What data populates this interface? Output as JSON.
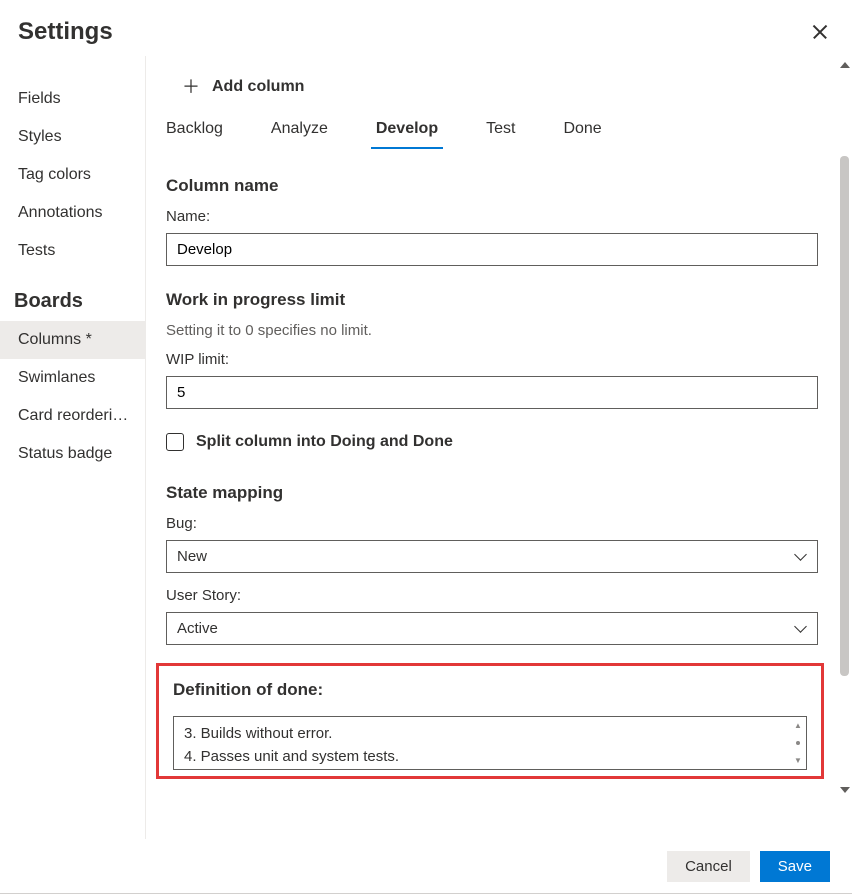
{
  "header": {
    "title": "Settings"
  },
  "sidebar": {
    "groups": [
      {
        "heading": null,
        "items": [
          {
            "label": "Fields"
          },
          {
            "label": "Styles"
          },
          {
            "label": "Tag colors"
          },
          {
            "label": "Annotations"
          },
          {
            "label": "Tests"
          }
        ]
      },
      {
        "heading": "Boards",
        "items": [
          {
            "label": "Columns *",
            "selected": true
          },
          {
            "label": "Swimlanes"
          },
          {
            "label": "Card reorderi…"
          },
          {
            "label": "Status badge"
          }
        ]
      }
    ]
  },
  "main": {
    "add_column_label": "Add column",
    "tabs": [
      {
        "label": "Backlog"
      },
      {
        "label": "Analyze"
      },
      {
        "label": "Develop",
        "active": true
      },
      {
        "label": "Test"
      },
      {
        "label": "Done"
      }
    ],
    "column_name": {
      "heading": "Column name",
      "name_label": "Name:",
      "name_value": "Develop"
    },
    "wip": {
      "heading": "Work in progress limit",
      "hint": "Setting it to 0 specifies no limit.",
      "limit_label": "WIP limit:",
      "limit_value": "5",
      "split_label": "Split column into Doing and Done"
    },
    "state_mapping": {
      "heading": "State mapping",
      "bug_label": "Bug:",
      "bug_value": "New",
      "user_story_label": "User Story:",
      "user_story_value": "Active"
    },
    "dod": {
      "heading": "Definition of done:",
      "line1": "3. Builds without error.",
      "line2": "4. Passes unit and system tests."
    }
  },
  "footer": {
    "cancel": "Cancel",
    "save": "Save"
  }
}
